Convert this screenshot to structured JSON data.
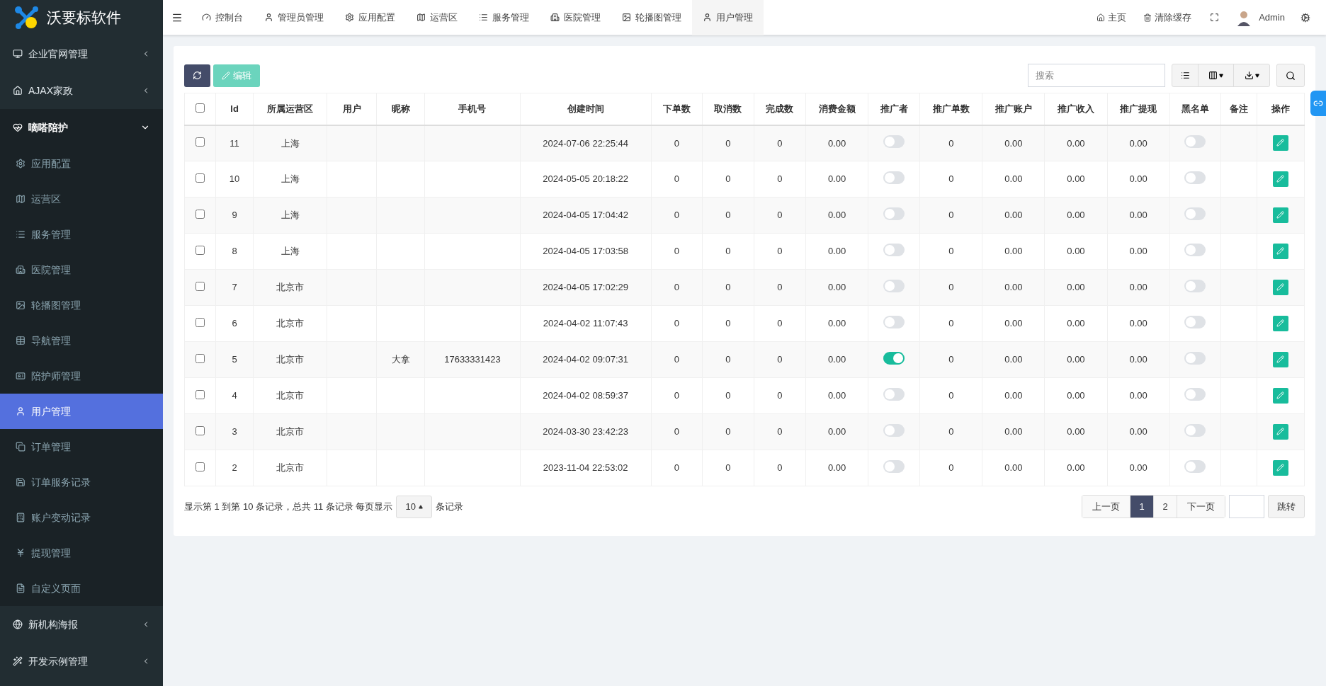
{
  "brand": {
    "name": "沃要标软件"
  },
  "sidebar": {
    "items": [
      {
        "label": "企业官网管理",
        "expanded": false,
        "selected": false
      },
      {
        "label": "AJAX家政",
        "expanded": false,
        "selected": false
      },
      {
        "label": "嘀嗒陪护",
        "expanded": true,
        "selected": false,
        "children": [
          {
            "label": "应用配置",
            "selected": false
          },
          {
            "label": "运营区",
            "selected": false
          },
          {
            "label": "服务管理",
            "selected": false
          },
          {
            "label": "医院管理",
            "selected": false
          },
          {
            "label": "轮播图管理",
            "selected": false
          },
          {
            "label": "导航管理",
            "selected": false
          },
          {
            "label": "陪护师管理",
            "selected": false
          },
          {
            "label": "用户管理",
            "selected": true
          },
          {
            "label": "订单管理",
            "selected": false
          },
          {
            "label": "订单服务记录",
            "selected": false
          },
          {
            "label": "账户变动记录",
            "selected": false
          },
          {
            "label": "提现管理",
            "selected": false
          },
          {
            "label": "自定义页面",
            "selected": false
          }
        ]
      },
      {
        "label": "新机构海报",
        "expanded": false,
        "selected": false
      },
      {
        "label": "开发示例管理",
        "expanded": false,
        "selected": false
      }
    ]
  },
  "tabs": [
    {
      "label": "控制台",
      "selected": false
    },
    {
      "label": "管理员管理",
      "selected": false
    },
    {
      "label": "应用配置",
      "selected": false
    },
    {
      "label": "运营区",
      "selected": false
    },
    {
      "label": "服务管理",
      "selected": false
    },
    {
      "label": "医院管理",
      "selected": false
    },
    {
      "label": "轮播图管理",
      "selected": false
    },
    {
      "label": "用户管理",
      "selected": true
    }
  ],
  "header_right": {
    "home": "主页",
    "clear_cache": "清除缓存",
    "user": "Admin"
  },
  "toolbar": {
    "edit": "编辑",
    "search_placeholder": "搜索"
  },
  "table": {
    "select_all_checked": false,
    "columns": [
      "Id",
      "所属运营区",
      "用户",
      "昵称",
      "手机号",
      "创建时间",
      "下单数",
      "取消数",
      "完成数",
      "消费金额",
      "推广者",
      "推广单数",
      "推广账户",
      "推广收入",
      "推广提现",
      "黑名单",
      "备注",
      "操作"
    ],
    "rows": [
      {
        "checked": false,
        "id": "11",
        "region": "上海",
        "user": "",
        "nickname": "",
        "phone": "",
        "created": "2024-07-06 22:25:44",
        "orders": "0",
        "cancelled": "0",
        "completed": "0",
        "spent": "0.00",
        "promoter": false,
        "promo_orders": "0",
        "promo_account": "0.00",
        "promo_income": "0.00",
        "promo_withdraw": "0.00",
        "blacklist": false
      },
      {
        "checked": false,
        "id": "10",
        "region": "上海",
        "user": "",
        "nickname": "",
        "phone": "",
        "created": "2024-05-05 20:18:22",
        "orders": "0",
        "cancelled": "0",
        "completed": "0",
        "spent": "0.00",
        "promoter": false,
        "promo_orders": "0",
        "promo_account": "0.00",
        "promo_income": "0.00",
        "promo_withdraw": "0.00",
        "blacklist": false
      },
      {
        "checked": false,
        "id": "9",
        "region": "上海",
        "user": "",
        "nickname": "",
        "phone": "",
        "created": "2024-04-05 17:04:42",
        "orders": "0",
        "cancelled": "0",
        "completed": "0",
        "spent": "0.00",
        "promoter": false,
        "promo_orders": "0",
        "promo_account": "0.00",
        "promo_income": "0.00",
        "promo_withdraw": "0.00",
        "blacklist": false
      },
      {
        "checked": false,
        "id": "8",
        "region": "上海",
        "user": "",
        "nickname": "",
        "phone": "",
        "created": "2024-04-05 17:03:58",
        "orders": "0",
        "cancelled": "0",
        "completed": "0",
        "spent": "0.00",
        "promoter": false,
        "promo_orders": "0",
        "promo_account": "0.00",
        "promo_income": "0.00",
        "promo_withdraw": "0.00",
        "blacklist": false
      },
      {
        "checked": false,
        "id": "7",
        "region": "北京市",
        "user": "",
        "nickname": "",
        "phone": "",
        "created": "2024-04-05 17:02:29",
        "orders": "0",
        "cancelled": "0",
        "completed": "0",
        "spent": "0.00",
        "promoter": false,
        "promo_orders": "0",
        "promo_account": "0.00",
        "promo_income": "0.00",
        "promo_withdraw": "0.00",
        "blacklist": false
      },
      {
        "checked": false,
        "id": "6",
        "region": "北京市",
        "user": "",
        "nickname": "",
        "phone": "",
        "created": "2024-04-02 11:07:43",
        "orders": "0",
        "cancelled": "0",
        "completed": "0",
        "spent": "0.00",
        "promoter": false,
        "promo_orders": "0",
        "promo_account": "0.00",
        "promo_income": "0.00",
        "promo_withdraw": "0.00",
        "blacklist": false
      },
      {
        "checked": false,
        "id": "5",
        "region": "北京市",
        "user": "",
        "nickname": "大拿",
        "phone": "17633331423",
        "created": "2024-04-02 09:07:31",
        "orders": "0",
        "cancelled": "0",
        "completed": "0",
        "spent": "0.00",
        "promoter": true,
        "promo_orders": "0",
        "promo_account": "0.00",
        "promo_income": "0.00",
        "promo_withdraw": "0.00",
        "blacklist": false
      },
      {
        "checked": false,
        "id": "4",
        "region": "北京市",
        "user": "",
        "nickname": "",
        "phone": "",
        "created": "2024-04-02 08:59:37",
        "orders": "0",
        "cancelled": "0",
        "completed": "0",
        "spent": "0.00",
        "promoter": false,
        "promo_orders": "0",
        "promo_account": "0.00",
        "promo_income": "0.00",
        "promo_withdraw": "0.00",
        "blacklist": false
      },
      {
        "checked": false,
        "id": "3",
        "region": "北京市",
        "user": "",
        "nickname": "",
        "phone": "",
        "created": "2024-03-30 23:42:23",
        "orders": "0",
        "cancelled": "0",
        "completed": "0",
        "spent": "0.00",
        "promoter": false,
        "promo_orders": "0",
        "promo_account": "0.00",
        "promo_income": "0.00",
        "promo_withdraw": "0.00",
        "blacklist": false
      },
      {
        "checked": false,
        "id": "2",
        "region": "北京市",
        "user": "",
        "nickname": "",
        "phone": "",
        "created": "2023-11-04 22:53:02",
        "orders": "0",
        "cancelled": "0",
        "completed": "0",
        "spent": "0.00",
        "promoter": false,
        "promo_orders": "0",
        "promo_account": "0.00",
        "promo_income": "0.00",
        "promo_withdraw": "0.00",
        "blacklist": false
      }
    ]
  },
  "footer": {
    "summary": "显示第 1 到第 10 条记录，总共 11 条记录 每页显示",
    "page_size": "10",
    "suffix": "条记录"
  },
  "pagination": {
    "prev": "上一页",
    "pages": [
      {
        "label": "1",
        "selected": true
      },
      {
        "label": "2",
        "selected": false
      }
    ],
    "next": "下一页",
    "jump": "跳转"
  }
}
